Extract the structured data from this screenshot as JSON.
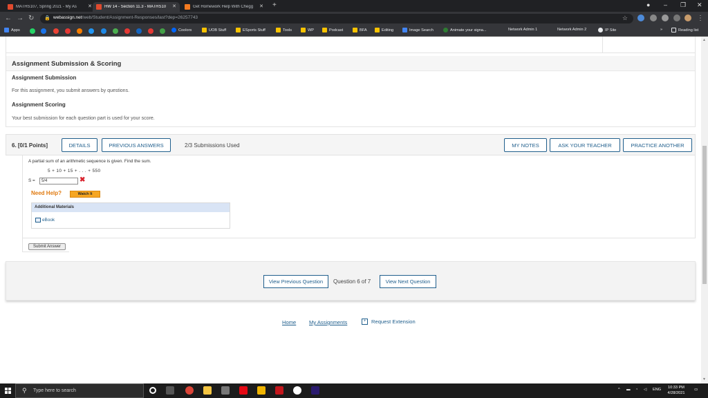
{
  "browser": {
    "tabs": [
      {
        "label": "MATHS107, Spring 2021 - My As",
        "active": false,
        "favicon_color": "#e04a2e"
      },
      {
        "label": "HW 14 - Section 11.3 - MATHS10",
        "active": true,
        "favicon_color": "#e04a2e"
      },
      {
        "label": "Get Homework Help With Chegg",
        "active": false,
        "favicon_color": "#f47a20"
      }
    ],
    "url_host": "webassign.net",
    "url_path": "/web/Student/Assignment-Responses/last?dep=26257743",
    "bookmarks": [
      "Apps",
      "Coolors",
      "UOB Stuff",
      "ESports Stuff",
      "Tools",
      "WP",
      "Podcast",
      "BFA",
      "Editing",
      "Image Search",
      "Animate your signa...",
      "Network Admin 1",
      "Network Admin 2",
      "IP Site",
      "Reading list"
    ]
  },
  "submission": {
    "panel_title": "Assignment Submission & Scoring",
    "submission_heading": "Assignment Submission",
    "submission_text": "For this assignment, you submit answers by questions.",
    "scoring_heading": "Assignment Scoring",
    "scoring_text": "Your best submission for each question part is used for your score."
  },
  "question": {
    "number_label": "6.  [0/1 Points]",
    "details_label": "DETAILS",
    "previous_answers_label": "PREVIOUS ANSWERS",
    "submissions_used": "2/3 Submissions Used",
    "my_notes_label": "MY NOTES",
    "ask_teacher_label": "ASK YOUR TEACHER",
    "practice_another_label": "PRACTICE ANOTHER",
    "prompt": "A partial sum of an arithmetic sequence is given. Find the sum.",
    "sequence": "5 + 10 + 15 + . . . + 550",
    "answer_label": "S =",
    "answer_value": "5/4",
    "answer_status": "✖",
    "need_help": "Need Help?",
    "watch_it": "Watch It",
    "additional_materials": "Additional Materials",
    "ebook": "eBook",
    "submit_label": "Submit Answer"
  },
  "navigation": {
    "prev_label": "View Previous Question",
    "position": "Question 6 of 7",
    "next_label": "View Next Question"
  },
  "footer": {
    "home": "Home",
    "my_assignments": "My Assignments",
    "request_extension": "Request Extension"
  },
  "taskbar": {
    "search_placeholder": "Type here to search",
    "language": "ENG",
    "time": "10:33 PM",
    "date": "4/28/2021"
  },
  "colors": {
    "link_blue": "#1f5e8c",
    "error_red": "#d9232e",
    "help_orange": "#e07a10"
  }
}
